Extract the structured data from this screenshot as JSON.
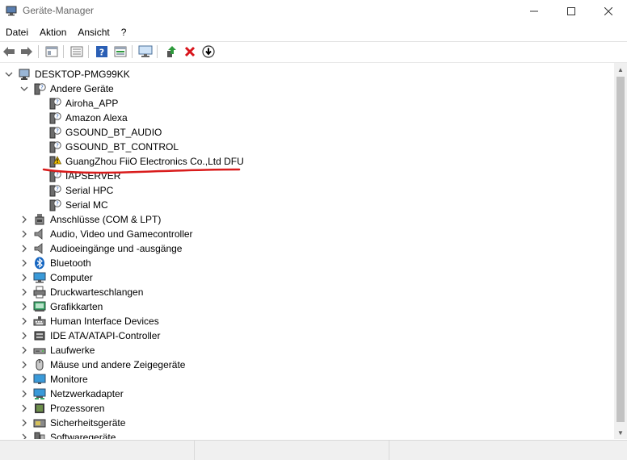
{
  "window": {
    "title": "Geräte-Manager"
  },
  "menu": [
    {
      "label": "Datei"
    },
    {
      "label": "Aktion"
    },
    {
      "label": "Ansicht"
    },
    {
      "label": "?"
    }
  ],
  "toolbar_icons": [
    "back-icon",
    "forward-icon",
    "properties-icon",
    "list-view-icon",
    "help-icon",
    "details-icon",
    "scan-hardware-icon",
    "update-driver-icon",
    "uninstall-icon",
    "disable-device-icon"
  ],
  "tree": {
    "root": {
      "label": "DESKTOP-PMG99KK",
      "icon": "computer-icon"
    },
    "expanded_category": {
      "label": "Andere Geräte",
      "icon": "unknown-device-icon",
      "children": [
        {
          "label": "Airoha_APP",
          "icon": "unknown-device-icon"
        },
        {
          "label": "Amazon Alexa",
          "icon": "unknown-device-icon"
        },
        {
          "label": "GSOUND_BT_AUDIO",
          "icon": "unknown-device-icon"
        },
        {
          "label": "GSOUND_BT_CONTROL",
          "icon": "unknown-device-icon"
        },
        {
          "label": "GuangZhou FiiO Electronics Co.,Ltd DFU",
          "icon": "warning-device-icon",
          "highlighted": true
        },
        {
          "label": "IAPSERVER",
          "icon": "unknown-device-icon"
        },
        {
          "label": "Serial HPC",
          "icon": "unknown-device-icon"
        },
        {
          "label": "Serial MC",
          "icon": "unknown-device-icon"
        }
      ]
    },
    "categories": [
      {
        "label": "Anschlüsse (COM & LPT)",
        "icon": "port-icon"
      },
      {
        "label": "Audio, Video und Gamecontroller",
        "icon": "speaker-icon"
      },
      {
        "label": "Audioeingänge und -ausgänge",
        "icon": "speaker-icon"
      },
      {
        "label": "Bluetooth",
        "icon": "bluetooth-icon"
      },
      {
        "label": "Computer",
        "icon": "monitor-icon"
      },
      {
        "label": "Druckwarteschlangen",
        "icon": "printer-icon"
      },
      {
        "label": "Grafikkarten",
        "icon": "display-adapter-icon"
      },
      {
        "label": "Human Interface Devices",
        "icon": "hid-icon"
      },
      {
        "label": "IDE ATA/ATAPI-Controller",
        "icon": "ide-controller-icon"
      },
      {
        "label": "Laufwerke",
        "icon": "drive-icon"
      },
      {
        "label": "Mäuse und andere Zeigegeräte",
        "icon": "mouse-icon"
      },
      {
        "label": "Monitore",
        "icon": "monitor-icon"
      },
      {
        "label": "Netzwerkadapter",
        "icon": "network-adapter-icon"
      },
      {
        "label": "Prozessoren",
        "icon": "processor-icon"
      },
      {
        "label": "Sicherheitsgeräte",
        "icon": "security-device-icon"
      },
      {
        "label": "Softwaregeräte",
        "icon": "software-device-icon"
      }
    ]
  },
  "colors": {
    "annotation_red": "#d91c1c",
    "warning_yellow": "#f5c400",
    "toolbar_green": "#2e9a3c",
    "uninstall_red": "#d8141b",
    "help_blue": "#2b5fb5"
  }
}
